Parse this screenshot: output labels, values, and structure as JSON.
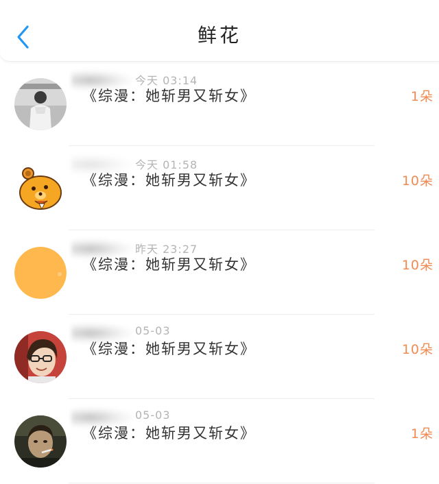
{
  "header": {
    "title": "鲜花",
    "back_icon": "chevron-left-icon",
    "accent_color": "#2196f3"
  },
  "rows": [
    {
      "time": "今天 03:14",
      "book": "《综漫：她斩男又斩女》",
      "count": "1朵",
      "avatar": "grayscale-photo-avatar"
    },
    {
      "time": "今天 01:58",
      "book": "《综漫：她斩男又斩女》",
      "count": "10朵",
      "avatar": "cartoon-bear-avatar"
    },
    {
      "time": "昨天 23:27",
      "book": "《综漫：她斩男又斩女》",
      "count": "10朵",
      "avatar": "orange-circle-avatar"
    },
    {
      "time": "05-03",
      "book": "《综漫：她斩男又斩女》",
      "count": "10朵",
      "avatar": "woman-with-glasses-avatar"
    },
    {
      "time": "05-03",
      "book": "《综漫：她斩男又斩女》",
      "count": "1朵",
      "avatar": "man-smoking-avatar"
    }
  ],
  "colors": {
    "count": "#f08a52",
    "time": "#b4b4b4"
  }
}
